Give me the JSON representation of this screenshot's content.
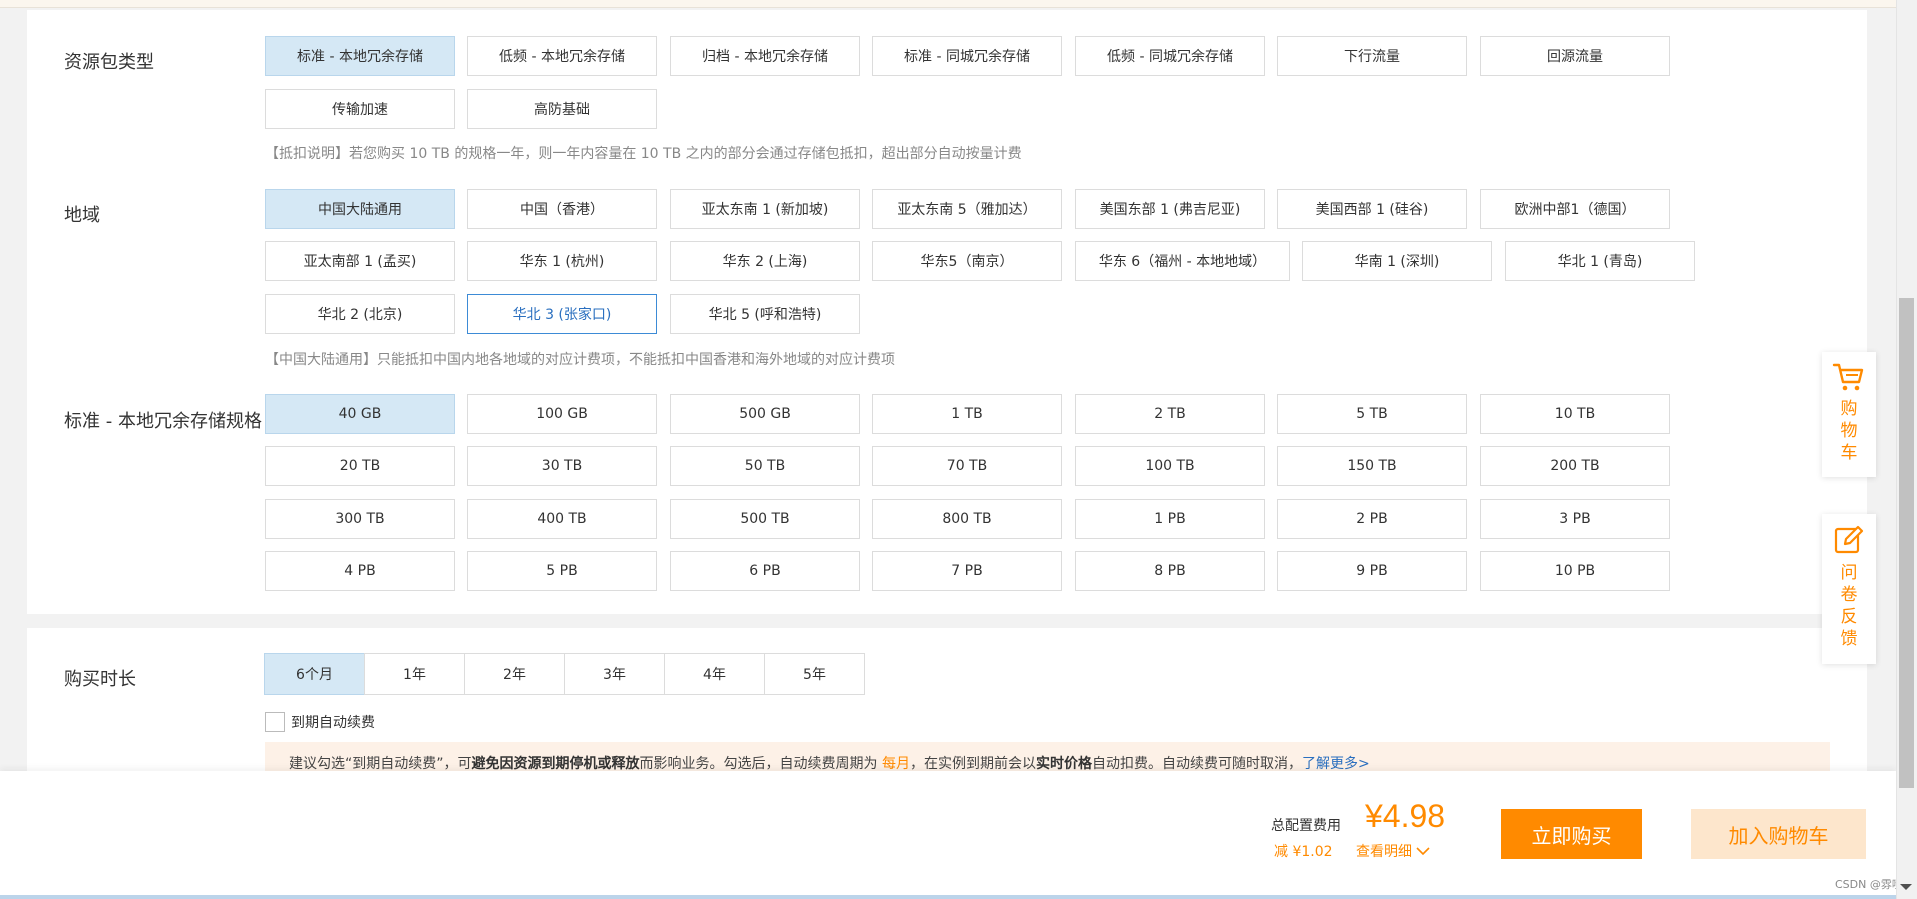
{
  "package_type": {
    "label": "资源包类型",
    "options": [
      "标准 - 本地冗余存储",
      "低频 - 本地冗余存储",
      "归档 - 本地冗余存储",
      "标准 - 同城冗余存储",
      "低频 - 同城冗余存储",
      "下行流量",
      "回源流量",
      "传输加速",
      "高防基础"
    ],
    "selected": "标准 - 本地冗余存储",
    "note": "【抵扣说明】若您购买 10 TB 的规格一年，则一年内容量在 10 TB 之内的部分会通过存储包抵扣，超出部分自动按量计费"
  },
  "region": {
    "label": "地域",
    "options": [
      "中国大陆通用",
      "中国（香港）",
      "亚太东南 1 (新加坡)",
      "亚太东南 5（雅加达）",
      "美国东部 1 (弗吉尼亚)",
      "美国西部 1 (硅谷)",
      "欧洲中部1（德国）",
      "亚太南部 1 (孟买)",
      "华东 1 (杭州)",
      "华东 2 (上海)",
      "华东5（南京）",
      "华东 6（福州 - 本地地域）",
      "华南 1 (深圳)",
      "华北 1 (青岛)",
      "华北 2 (北京)",
      "华北 3 (张家口)",
      "华北 5 (呼和浩特)"
    ],
    "selected": "中国大陆通用",
    "hovered": "华北 3 (张家口)",
    "note": "【中国大陆通用】只能抵扣中国内地各地域的对应计费项，不能抵扣中国香港和海外地域的对应计费项"
  },
  "spec": {
    "label": "标准 - 本地冗余存储规格",
    "options": [
      "40 GB",
      "100 GB",
      "500 GB",
      "1 TB",
      "2 TB",
      "5 TB",
      "10 TB",
      "20 TB",
      "30 TB",
      "50 TB",
      "70 TB",
      "100 TB",
      "150 TB",
      "200 TB",
      "300 TB",
      "400 TB",
      "500 TB",
      "800 TB",
      "1 PB",
      "2 PB",
      "3 PB",
      "4 PB",
      "5 PB",
      "6 PB",
      "7 PB",
      "8 PB",
      "9 PB",
      "10 PB"
    ],
    "selected": "40 GB"
  },
  "duration": {
    "label": "购买时长",
    "options": [
      "6个月",
      "1年",
      "2年",
      "3年",
      "4年",
      "5年"
    ],
    "selected": "6个月",
    "auto_renew_label": "到期自动续费",
    "auto_renew_checked": false
  },
  "tip": {
    "t1": "建议勾选“到期自动续费”，可",
    "b1": "避免因资源到期停机或释放",
    "t2": "而影响业务。勾选后，自动续费周期为 ",
    "o1": "每月",
    "t3": "，在实例到期前会以",
    "b2": "实时价格",
    "t4": "自动扣费。自动续费可随时取消，",
    "link": "了解更多>"
  },
  "footer": {
    "total_label": "总配置费用",
    "price": "¥4.98",
    "discount": "减 ¥1.02",
    "detail": "查看明细",
    "buy": "立即购买",
    "add_cart": "加入购物车",
    "watermark": "CSDN @雰哑"
  },
  "side": {
    "cart": "购物车",
    "feedback": "问卷反馈"
  },
  "colors": {
    "accent": "#ff8a00",
    "selected_bg": "#d5e8f5",
    "link": "#2a6fbf"
  }
}
